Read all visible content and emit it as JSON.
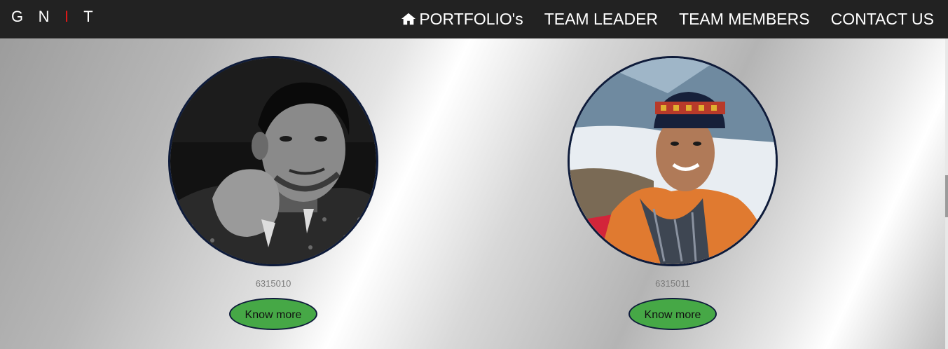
{
  "brand": {
    "part1": "G N ",
    "accent": "I",
    "part2": " T"
  },
  "nav": {
    "portfolio": "PORTFOLIO's",
    "team_leader": "TEAM LEADER",
    "team_members": "TEAM MEMBERS",
    "contact_us": "CONTACT US"
  },
  "members": [
    {
      "id": "6315010",
      "button": "Know more"
    },
    {
      "id": "6315011",
      "button": "Know more"
    }
  ],
  "colors": {
    "navbar_bg": "#222222",
    "brand_accent": "#e01818",
    "button_bg": "#46a846",
    "border": "#0e1b3a"
  },
  "icons": {
    "portfolio": "home-icon"
  }
}
